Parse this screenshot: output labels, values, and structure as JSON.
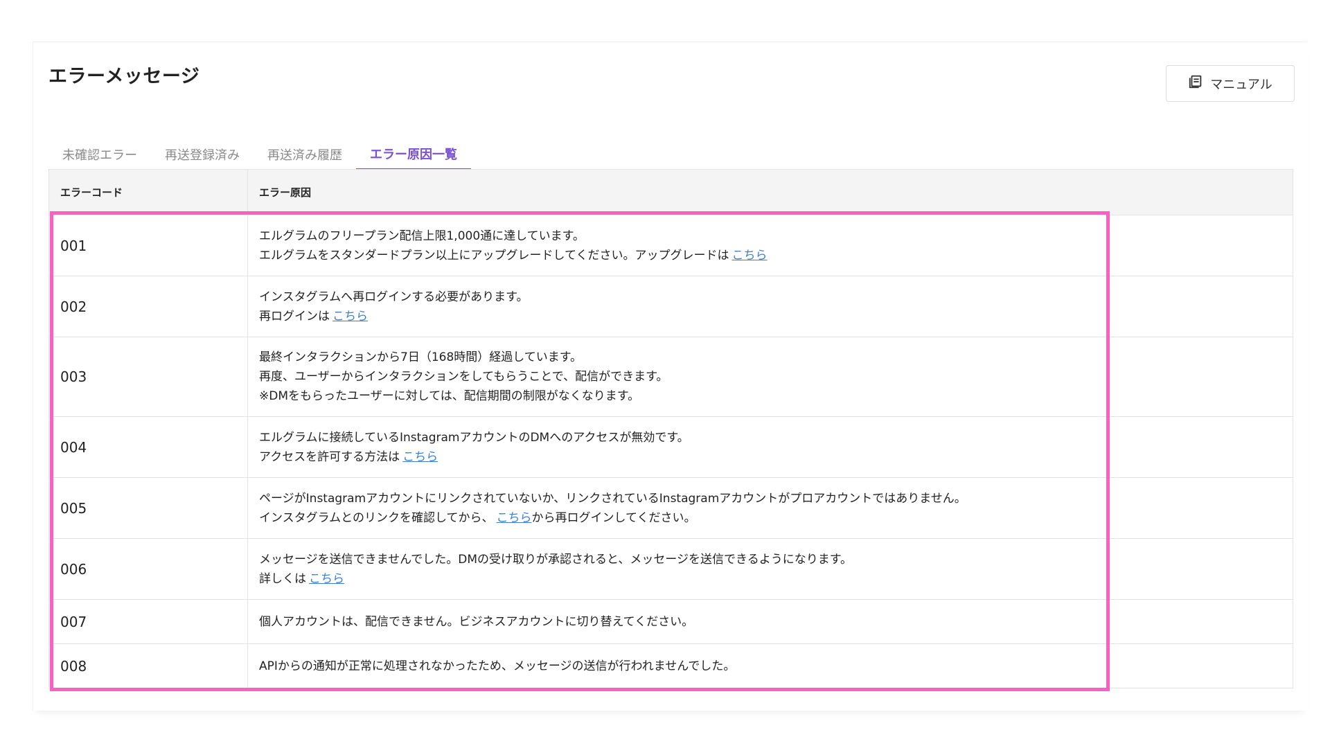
{
  "page": {
    "title": "エラーメッセージ",
    "manual_button": "マニュアル"
  },
  "tabs": [
    {
      "label": "未確認エラー",
      "active": false
    },
    {
      "label": "再送登録済み",
      "active": false
    },
    {
      "label": "再送済み履歴",
      "active": false
    },
    {
      "label": "エラー原因一覧",
      "active": true
    }
  ],
  "table": {
    "headers": {
      "code": "エラーコード",
      "cause": "エラー原因"
    },
    "rows": [
      {
        "code": "001",
        "lines": [
          "エルグラムのフリープラン配信上限1,000通に達しています。",
          "エルグラムをスタンダードプラン以上にアップグレードしてください。アップグレードは"
        ],
        "link": "こちら",
        "suffix": ""
      },
      {
        "code": "002",
        "lines": [
          "インスタグラムへ再ログインする必要があります。",
          "再ログインは"
        ],
        "link": "こちら",
        "suffix": ""
      },
      {
        "code": "003",
        "lines": [
          "最終インタラクションから7日（168時間）経過しています。",
          "再度、ユーザーからインタラクションをしてもらうことで、配信ができます。",
          "※DMをもらったユーザーに対しては、配信期間の制限がなくなります。"
        ],
        "link": "",
        "suffix": ""
      },
      {
        "code": "004",
        "lines": [
          "エルグラムに接続しているInstagramアカウントのDMへのアクセスが無効です。",
          "アクセスを許可する方法は"
        ],
        "link": "こちら",
        "suffix": ""
      },
      {
        "code": "005",
        "lines": [
          "ページがInstagramアカウントにリンクされていないか、リンクされているInstagramアカウントがプロアカウントではありません。",
          "インスタグラムとのリンクを確認してから、"
        ],
        "link": "こちら",
        "suffix": "から再ログインしてください。"
      },
      {
        "code": "006",
        "lines": [
          "メッセージを送信できませんでした。DMの受け取りが承認されると、メッセージを送信できるようになります。",
          "詳しくは"
        ],
        "link": "こちら",
        "suffix": ""
      },
      {
        "code": "007",
        "lines": [
          "個人アカウントは、配信できません。ビジネスアカウントに切り替えてください。"
        ],
        "link": "",
        "suffix": ""
      },
      {
        "code": "008",
        "lines": [
          "APIからの通知が正常に処理されなかったため、メッセージの送信が行われませんでした。"
        ],
        "link": "",
        "suffix": ""
      }
    ]
  },
  "colors": {
    "accent": "#7b4fd6",
    "link": "#3b7fd4",
    "highlight": "#ff5fc3"
  }
}
